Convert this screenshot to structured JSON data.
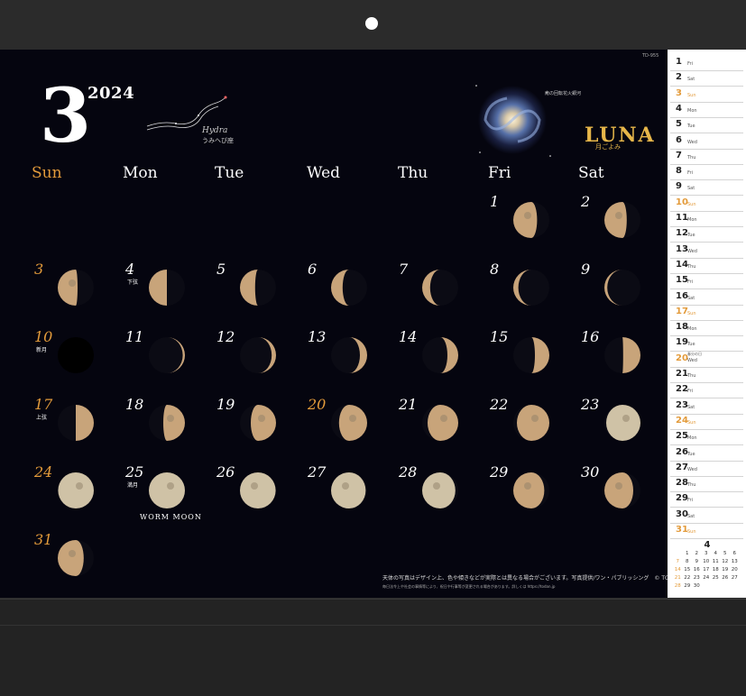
{
  "year": "2024",
  "month": "3",
  "product_code": "TD-955",
  "constellation": {
    "name": "Hydra",
    "jp": "うみへび座"
  },
  "galaxy_caption": "南の回転花火銀河",
  "brand": {
    "title": "LUNA",
    "subtitle": "月ごよみ"
  },
  "weekdays": [
    "Sun",
    "Mon",
    "Tue",
    "Wed",
    "Thu",
    "Fri",
    "Sat"
  ],
  "days": [
    {
      "n": "1",
      "label": ""
    },
    {
      "n": "2",
      "label": ""
    },
    {
      "n": "3",
      "label": ""
    },
    {
      "n": "4",
      "label": "下弦"
    },
    {
      "n": "5",
      "label": ""
    },
    {
      "n": "6",
      "label": ""
    },
    {
      "n": "7",
      "label": ""
    },
    {
      "n": "8",
      "label": ""
    },
    {
      "n": "9",
      "label": ""
    },
    {
      "n": "10",
      "label": "新月"
    },
    {
      "n": "11",
      "label": ""
    },
    {
      "n": "12",
      "label": ""
    },
    {
      "n": "13",
      "label": ""
    },
    {
      "n": "14",
      "label": ""
    },
    {
      "n": "15",
      "label": ""
    },
    {
      "n": "16",
      "label": ""
    },
    {
      "n": "17",
      "label": "上弦"
    },
    {
      "n": "18",
      "label": ""
    },
    {
      "n": "19",
      "label": ""
    },
    {
      "n": "20",
      "label": ""
    },
    {
      "n": "21",
      "label": ""
    },
    {
      "n": "22",
      "label": ""
    },
    {
      "n": "23",
      "label": ""
    },
    {
      "n": "24",
      "label": ""
    },
    {
      "n": "25",
      "label": "満月"
    },
    {
      "n": "26",
      "label": ""
    },
    {
      "n": "27",
      "label": ""
    },
    {
      "n": "28",
      "label": ""
    },
    {
      "n": "29",
      "label": ""
    },
    {
      "n": "30",
      "label": ""
    },
    {
      "n": "31",
      "label": ""
    }
  ],
  "full_moon_name": "WORM MOON",
  "footnote": "天体の写真はデザイン上、色や傾きなどが実際とは異なる場合がございます。写真提供/ワン・パブリッシング　© TODAN",
  "footnote2": "毎日法令上や社会の事情等により、祝日や行事等が変更される場合があります。詳しくは https://todan.jp",
  "sidebar": [
    {
      "n": "1",
      "d": "Fri"
    },
    {
      "n": "2",
      "d": "Sat"
    },
    {
      "n": "3",
      "d": "Sun"
    },
    {
      "n": "4",
      "d": "Mon"
    },
    {
      "n": "5",
      "d": "Tue"
    },
    {
      "n": "6",
      "d": "Wed"
    },
    {
      "n": "7",
      "d": "Thu"
    },
    {
      "n": "8",
      "d": "Fri"
    },
    {
      "n": "9",
      "d": "Sat"
    },
    {
      "n": "10",
      "d": "Sun"
    },
    {
      "n": "11",
      "d": "Mon"
    },
    {
      "n": "12",
      "d": "Tue"
    },
    {
      "n": "13",
      "d": "Wed"
    },
    {
      "n": "14",
      "d": "Thu"
    },
    {
      "n": "15",
      "d": "Fri"
    },
    {
      "n": "16",
      "d": "Sat"
    },
    {
      "n": "17",
      "d": "Sun"
    },
    {
      "n": "18",
      "d": "Mon"
    },
    {
      "n": "19",
      "d": "Tue"
    },
    {
      "n": "20",
      "d": "Wed",
      "note": "春分の日"
    },
    {
      "n": "21",
      "d": "Thu"
    },
    {
      "n": "22",
      "d": "Fri"
    },
    {
      "n": "23",
      "d": "Sat"
    },
    {
      "n": "24",
      "d": "Sun"
    },
    {
      "n": "25",
      "d": "Mon"
    },
    {
      "n": "26",
      "d": "Tue"
    },
    {
      "n": "27",
      "d": "Wed"
    },
    {
      "n": "28",
      "d": "Thu"
    },
    {
      "n": "29",
      "d": "Fri"
    },
    {
      "n": "30",
      "d": "Sat"
    },
    {
      "n": "31",
      "d": "Sun"
    }
  ],
  "mini_calendar": {
    "title": "4",
    "rows": [
      [
        "",
        "1",
        "2",
        "3",
        "4",
        "5",
        "6"
      ],
      [
        "7",
        "8",
        "9",
        "10",
        "11",
        "12",
        "13"
      ],
      [
        "14",
        "15",
        "16",
        "17",
        "18",
        "19",
        "20"
      ],
      [
        "21",
        "22",
        "23",
        "24",
        "25",
        "26",
        "27"
      ],
      [
        "28",
        "29",
        "30",
        "",
        "",
        "",
        ""
      ]
    ]
  },
  "colors": {
    "accent": "#e39b3b",
    "brand": "#e6b64a",
    "background": "#05050f"
  }
}
